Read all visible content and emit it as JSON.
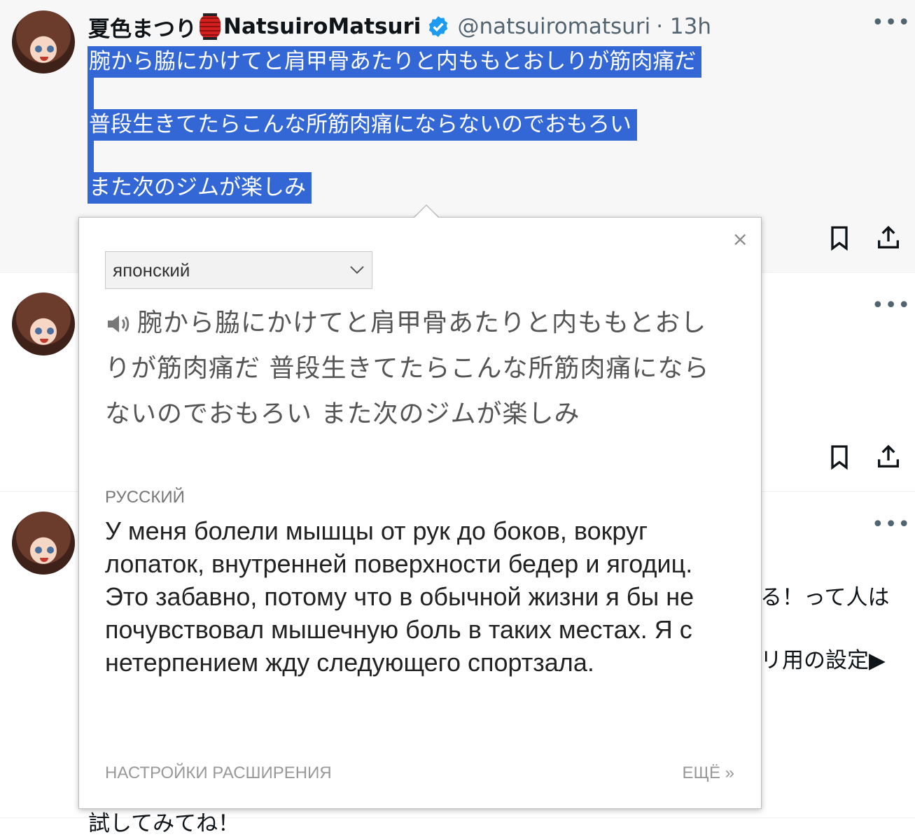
{
  "tweet": {
    "display_name": "夏色まつり",
    "display_name_en": "NatsuiroMatsuri",
    "handle": "@natsuiromatsuri",
    "time": "· 13h",
    "body": [
      "腕から脇にかけてと肩甲骨あたりと内ももとおしりが筋肉痛だ",
      "",
      "普段生きてたらこんな所筋肉痛にならないのでおもろい",
      "",
      "また次のジムが楽しみ"
    ],
    "more_label": "•••"
  },
  "peek_text": {
    "line1": "る！って人は",
    "line2": "リ用の設定▶",
    "bottom": "試してみてね！"
  },
  "popup": {
    "close_label": "×",
    "source_lang": "японский",
    "source_text": "腕から脇にかけてと肩甲骨あたりと内ももとおしりが筋肉痛だ 普段生きてたらこんな所筋肉痛にならないのでおもろい また次のジムが楽しみ",
    "target_lang": "РУССКИЙ",
    "translation": "У меня болели мышцы от рук до боков, вокруг лопаток, внутренней поверхности бедер и ягодиц. Это забавно, потому что в обычной жизни я бы не почувствовал мышечную боль в таких местах. Я с нетерпением жду следующего спортзала.",
    "settings_link": "НАСТРОЙКИ РАСШИРЕНИЯ",
    "more_link": "ЕЩЁ »"
  },
  "colors": {
    "selection": "#3367d6",
    "verified": "#1d9bf0",
    "muted": "#536471"
  }
}
